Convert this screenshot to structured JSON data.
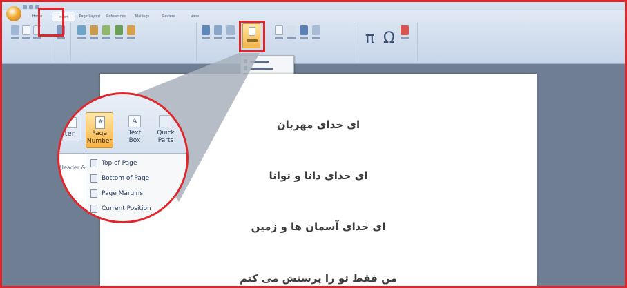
{
  "ribbon": {
    "tabs": [
      "Home",
      "Insert",
      "Page Layout",
      "References",
      "Mailings",
      "Review",
      "View"
    ],
    "active_tab_index": 1,
    "page_number_label": "Page Number",
    "symbol_pi": "π",
    "symbol_omega": "Ω"
  },
  "zoom": {
    "footer_label": "Footer",
    "page_number_line1": "Page",
    "page_number_line2": "Number",
    "text_box_line1": "Text",
    "text_box_line2": "Box",
    "text_box_icon": "A",
    "quick_parts_line1": "Quick",
    "quick_parts_line2": "Parts",
    "group_label": "Header & F",
    "menu_items": [
      "Top of Page",
      "Bottom of Page",
      "Page Margins",
      "Current Position"
    ]
  },
  "document": {
    "lines": [
      "ای خدای مهربان",
      "ای خدای دانا و توانا",
      "ای خدای آسمان ها و زمین",
      "من فقط تو را پرستش می کنم"
    ]
  },
  "colors": {
    "highlight": "#e0262b",
    "ribbon": "#d3dfee",
    "workspace": "#6f7e93",
    "page_number_button": "#f7b54a"
  }
}
